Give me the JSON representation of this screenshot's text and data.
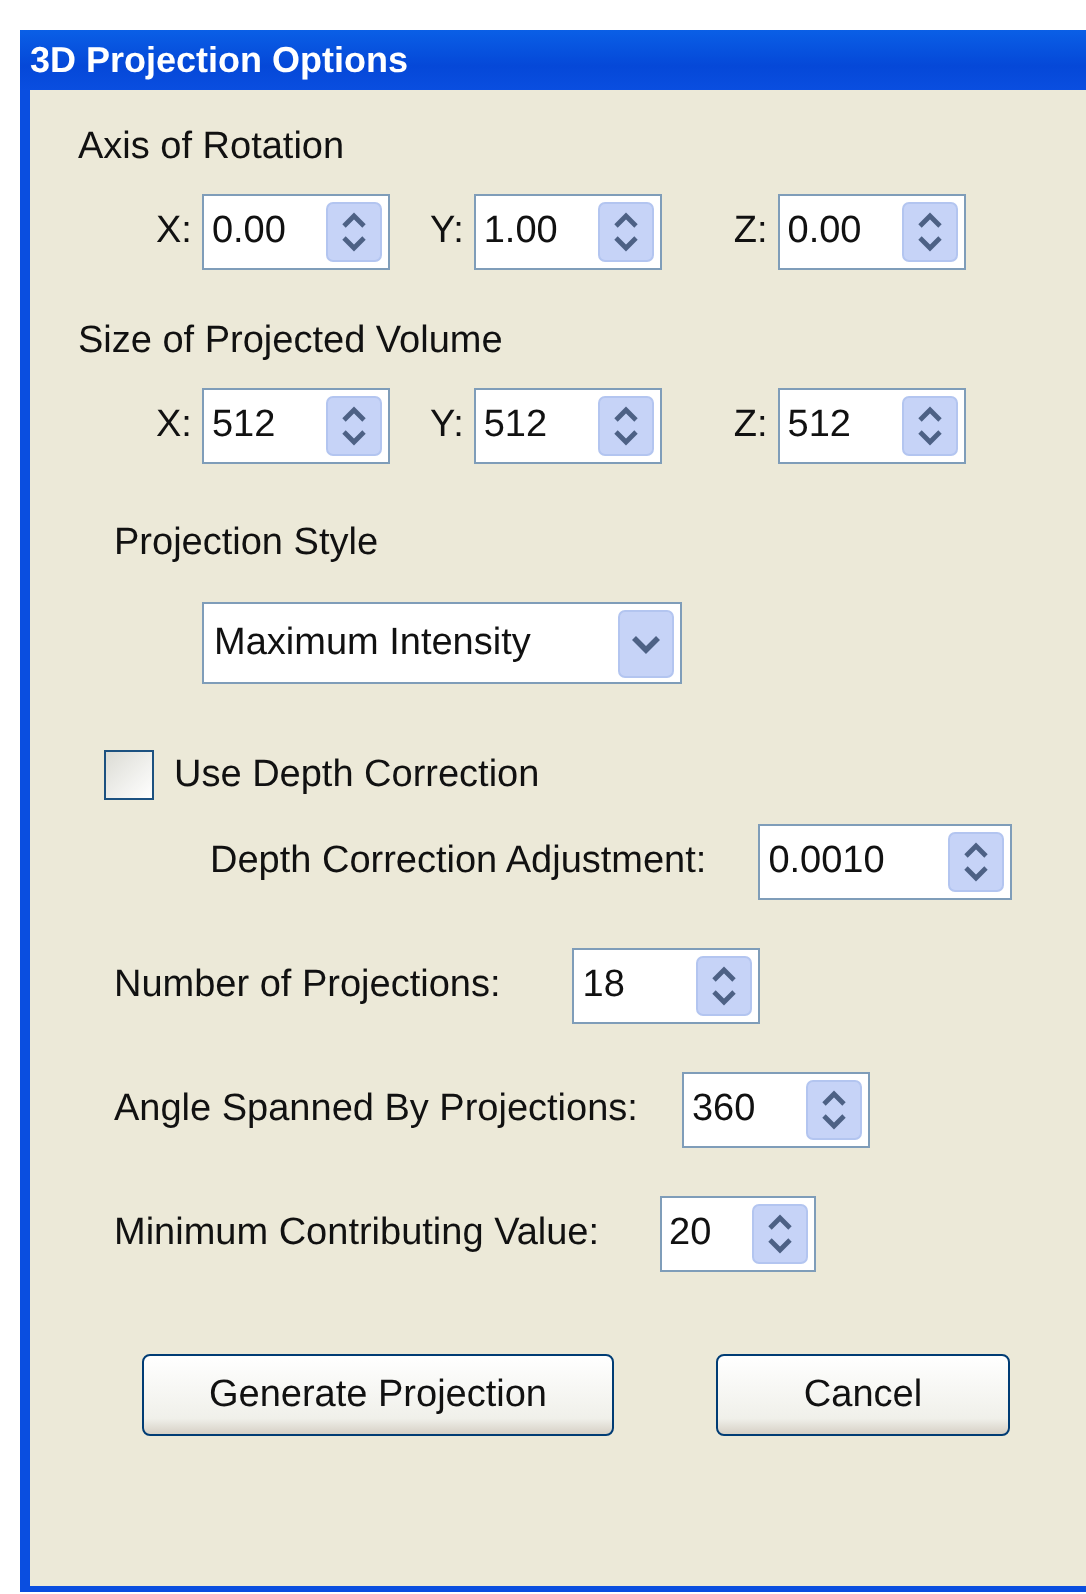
{
  "window": {
    "title": "3D Projection Options"
  },
  "axis_of_rotation": {
    "label": "Axis of Rotation",
    "fields": [
      {
        "label": "X:",
        "value": "0.00"
      },
      {
        "label": "Y:",
        "value": "1.00"
      },
      {
        "label": "Z:",
        "value": "0.00"
      }
    ]
  },
  "size_of_projected_volume": {
    "label": "Size of Projected Volume",
    "fields": [
      {
        "label": "X:",
        "value": "512"
      },
      {
        "label": "Y:",
        "value": "512"
      },
      {
        "label": "Z:",
        "value": "512"
      }
    ]
  },
  "projection_style": {
    "label": "Projection Style",
    "value": "Maximum Intensity"
  },
  "depth_correction": {
    "label": "Use Depth Correction",
    "checked": false,
    "adjustment": {
      "label": "Depth Correction Adjustment:",
      "value": "0.0010"
    }
  },
  "settings": [
    {
      "label": "Number of Projections:",
      "value": "18"
    },
    {
      "label": "Angle Spanned By Projections:",
      "value": "360"
    },
    {
      "label": "Minimum Contributing Value:",
      "value": "20"
    }
  ],
  "buttons": [
    "Generate Projection",
    "Cancel"
  ]
}
